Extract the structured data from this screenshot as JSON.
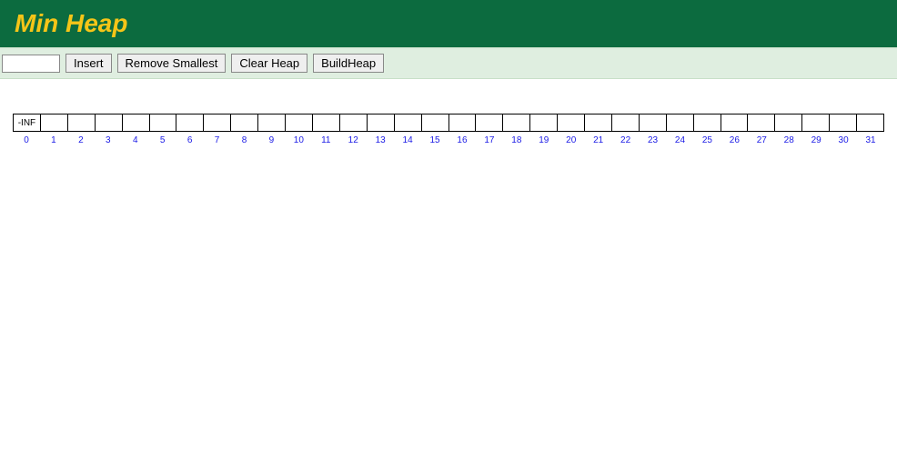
{
  "header": {
    "title": "Min Heap"
  },
  "toolbar": {
    "input_value": "",
    "insert_label": "Insert",
    "remove_label": "Remove Smallest",
    "clear_label": "Clear Heap",
    "build_label": "BuildHeap"
  },
  "array": {
    "cells": [
      "-INF",
      "",
      "",
      "",
      "",
      "",
      "",
      "",
      "",
      "",
      "",
      "",
      "",
      "",
      "",
      "",
      "",
      "",
      "",
      "",
      "",
      "",
      "",
      "",
      "",
      "",
      "",
      "",
      "",
      "",
      "",
      ""
    ],
    "indices": [
      "0",
      "1",
      "2",
      "3",
      "4",
      "5",
      "6",
      "7",
      "8",
      "9",
      "10",
      "11",
      "12",
      "13",
      "14",
      "15",
      "16",
      "17",
      "18",
      "19",
      "20",
      "21",
      "22",
      "23",
      "24",
      "25",
      "26",
      "27",
      "28",
      "29",
      "30",
      "31"
    ]
  }
}
